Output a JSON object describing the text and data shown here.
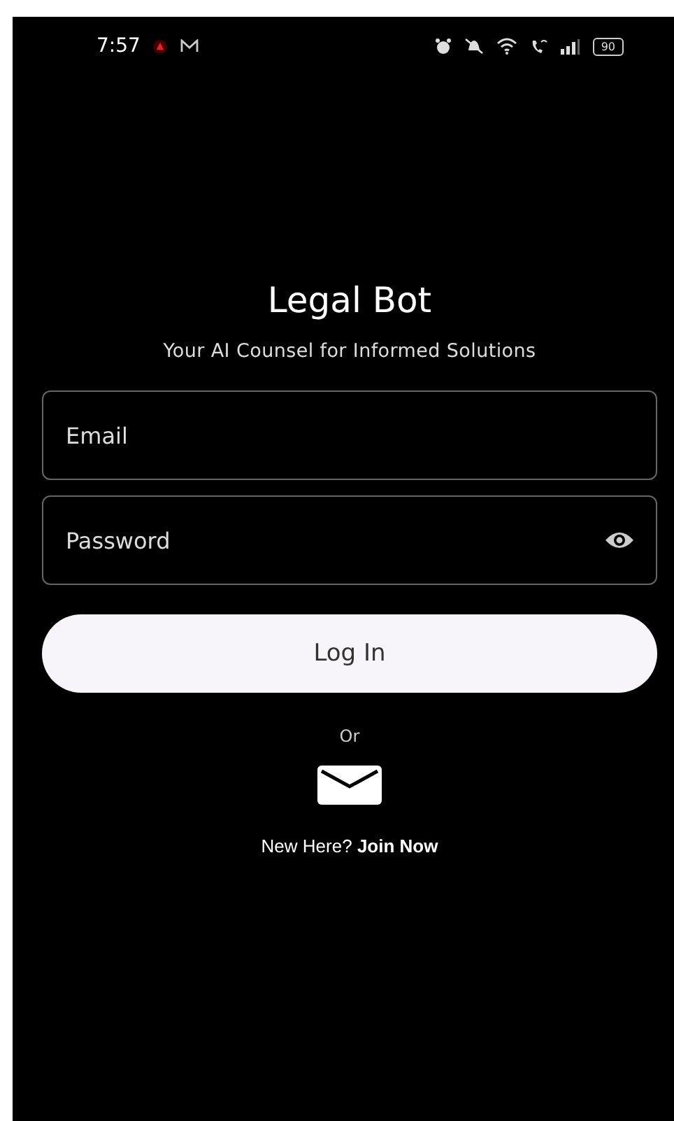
{
  "status_bar": {
    "time": "7:57",
    "battery": "90"
  },
  "app": {
    "title": "Legal Bot",
    "subtitle": "Your AI Counsel for Informed Solutions"
  },
  "fields": [
    {
      "kind": "email",
      "placeholder": "Email"
    },
    {
      "kind": "password",
      "placeholder": "Password"
    }
  ],
  "login_button": "Log In",
  "divider_text": "Or",
  "signup": {
    "prompt": "New Here?",
    "link": "Join Now"
  }
}
